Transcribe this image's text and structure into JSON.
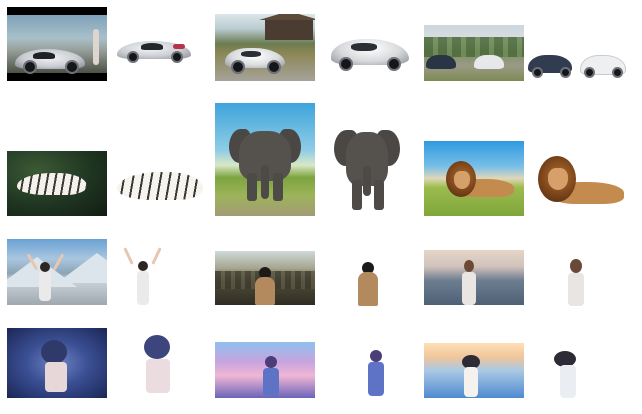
{
  "gallery": {
    "rows": [
      {
        "category": "cars",
        "pairs": [
          {
            "original": "car-photo-1",
            "cutout": "car-cutout-1"
          },
          {
            "original": "car-photo-2",
            "cutout": "car-cutout-2"
          },
          {
            "original": "car-photo-3",
            "cutout": "car-cutout-3"
          }
        ]
      },
      {
        "category": "animals",
        "pairs": [
          {
            "original": "tiger-photo",
            "cutout": "tiger-cutout"
          },
          {
            "original": "elephant-photo",
            "cutout": "elephant-cutout"
          },
          {
            "original": "lion-photo",
            "cutout": "lion-cutout"
          }
        ]
      },
      {
        "category": "people",
        "pairs": [
          {
            "original": "girl-mountain-photo",
            "cutout": "girl-mountain-cutout"
          },
          {
            "original": "girl-hills-photo",
            "cutout": "girl-hills-cutout"
          },
          {
            "original": "girl-sea-photo",
            "cutout": "girl-sea-cutout"
          }
        ]
      },
      {
        "category": "anime",
        "pairs": [
          {
            "original": "anime-1-photo",
            "cutout": "anime-1-cutout"
          },
          {
            "original": "anime-2-photo",
            "cutout": "anime-2-cutout"
          },
          {
            "original": "anime-3-photo",
            "cutout": "anime-3-cutout"
          }
        ]
      }
    ]
  },
  "colors": {
    "background": "#ffffff"
  }
}
